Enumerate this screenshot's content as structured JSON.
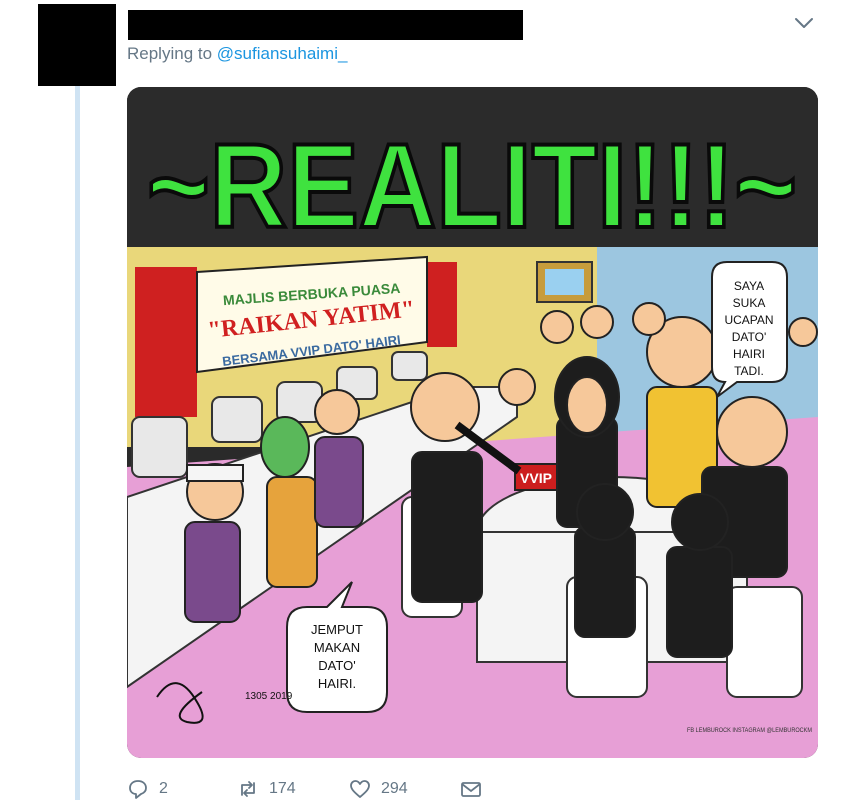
{
  "tweet": {
    "replying_prefix": "Replying to",
    "replying_handle": "@sufiansuhaimi_",
    "more_icon": "chevron-down-icon"
  },
  "image": {
    "headline": "~REALITI!!!~",
    "banner_line1": "MAJLIS BERBUKA PUASA",
    "banner_line2": "\"RAIKAN YATIM\"",
    "banner_line3": "BERSAMA VVIP DATO' HAIRI",
    "vvip_sign": "VVIP",
    "speech_right": [
      "SAYA",
      "SUKA",
      "UCAPAN",
      "DATO'",
      "HAIRI",
      "TADI."
    ],
    "speech_left": [
      "JEMPUT",
      "MAKAN",
      "DATO'",
      "HAIRI."
    ],
    "signature_date": "1305 2019",
    "credit": "FB LEMBUROCK  INSTAGRAM @LEMBUROCKM"
  },
  "actions": {
    "reply_count": "2",
    "retweet_count": "174",
    "like_count": "294",
    "icons": [
      "reply-icon",
      "retweet-icon",
      "like-icon",
      "dm-icon"
    ]
  },
  "colors": {
    "handle_blue": "#1b95e0",
    "muted_gray": "#657786",
    "thread_line": "#cfe3f3",
    "headline_green": "#3fe23f"
  }
}
